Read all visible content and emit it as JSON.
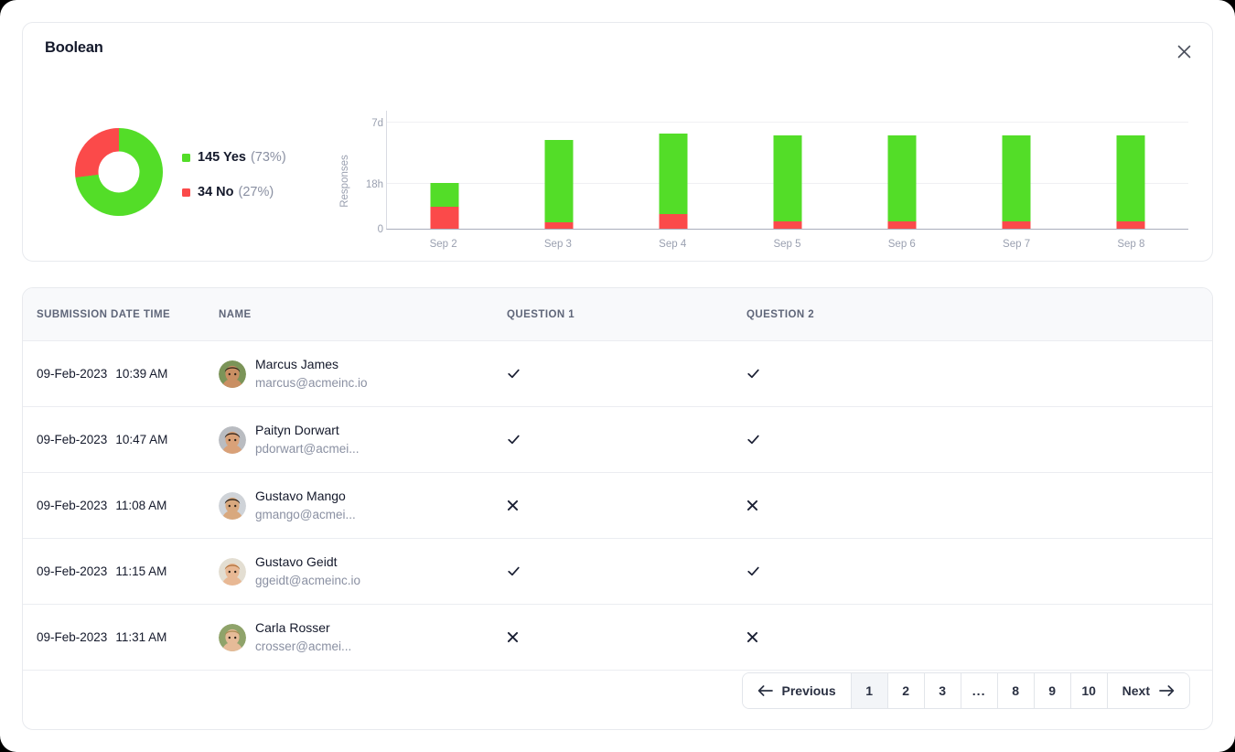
{
  "card": {
    "title": "Boolean",
    "close_icon": "close-icon"
  },
  "colors": {
    "yes": "#53dd28",
    "no": "#fb4a4a",
    "text": "#14192b",
    "muted": "#8a90a2"
  },
  "donut": {
    "legend": [
      {
        "swatch": "#53dd28",
        "main": "145 Yes",
        "pct": "(73%)",
        "value": 145,
        "percent": 73
      },
      {
        "swatch": "#fb4a4a",
        "main": "34 No",
        "pct": "(27%)",
        "value": 34,
        "percent": 27
      }
    ]
  },
  "chart_data": {
    "type": "bar",
    "stacked": true,
    "title": "",
    "xlabel": "",
    "ylabel": "Responses",
    "categories": [
      "Sep 2",
      "Sep 3",
      "Sep 4",
      "Sep 5",
      "Sep 6",
      "Sep 7",
      "Sep 8"
    ],
    "ytick_labels": [
      "0",
      "18h",
      "7d"
    ],
    "ytick_positions": [
      0,
      42,
      100
    ],
    "ylim": [
      0,
      112
    ],
    "grid": true,
    "legend_position": "left",
    "series": [
      {
        "name": "Yes",
        "color": "#53dd28",
        "values": [
          22,
          78,
          76,
          81,
          81,
          81,
          81
        ]
      },
      {
        "name": "No",
        "color": "#fb4a4a",
        "values": [
          21,
          6,
          14,
          7,
          7,
          7,
          7
        ]
      }
    ]
  },
  "table": {
    "columns": [
      "SUBMISSION DATE TIME",
      "NAME",
      "QUESTION 1",
      "QUESTION 2"
    ],
    "rows": [
      {
        "date": "09-Feb-2023",
        "time": "10:39 AM",
        "name": "Marcus James",
        "email": "marcus@acmeinc.io",
        "q1": "check",
        "q2": "check",
        "avatar": {
          "skin": "#c98f63",
          "hair": "#2b2118",
          "bg": "#7b9458"
        }
      },
      {
        "date": "09-Feb-2023",
        "time": "10:47 AM",
        "name": "Paityn Dorwart",
        "email": "pdorwart@acmei...",
        "q1": "check",
        "q2": "check",
        "avatar": {
          "skin": "#d9a178",
          "hair": "#241a13",
          "bg": "#b9bcc1"
        }
      },
      {
        "date": "09-Feb-2023",
        "time": "11:08 AM",
        "name": "Gustavo Mango",
        "email": "gmango@acmei...",
        "q1": "cross",
        "q2": "cross",
        "avatar": {
          "skin": "#d8a87e",
          "hair": "#1d1711",
          "bg": "#cfd3d8"
        }
      },
      {
        "date": "09-Feb-2023",
        "time": "11:15 AM",
        "name": "Gustavo Geidt",
        "email": "ggeidt@acmeinc.io",
        "q1": "check",
        "q2": "check",
        "avatar": {
          "skin": "#e8b894",
          "hair": "#b0703a",
          "bg": "#e3ded2"
        }
      },
      {
        "date": "09-Feb-2023",
        "time": "11:31 AM",
        "name": "Carla Rosser",
        "email": "crosser@acmei...",
        "q1": "cross",
        "q2": "cross",
        "avatar": {
          "skin": "#e6bb98",
          "hair": "#a98a52",
          "bg": "#8fa36a"
        }
      }
    ]
  },
  "pagination": {
    "previous_label": "Previous",
    "next_label": "Next",
    "pages": [
      "1",
      "2",
      "3",
      "...",
      "8",
      "9",
      "10"
    ],
    "active_page": "1"
  }
}
